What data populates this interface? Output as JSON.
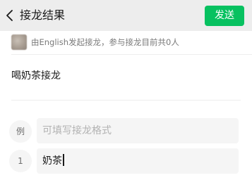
{
  "header": {
    "title": "接龙结果",
    "send_label": "发送"
  },
  "info": {
    "text": "由English发起接龙，参与接龙目前共0人"
  },
  "topic": "喝奶茶接龙",
  "rows": [
    {
      "num": "例",
      "placeholder": "可填写接龙格式",
      "value": ""
    },
    {
      "num": "1",
      "placeholder": "",
      "value": "奶茶"
    }
  ],
  "colors": {
    "header_bg": "#ededed",
    "accent": "#07c160",
    "field_bg": "#f5f5f5"
  }
}
